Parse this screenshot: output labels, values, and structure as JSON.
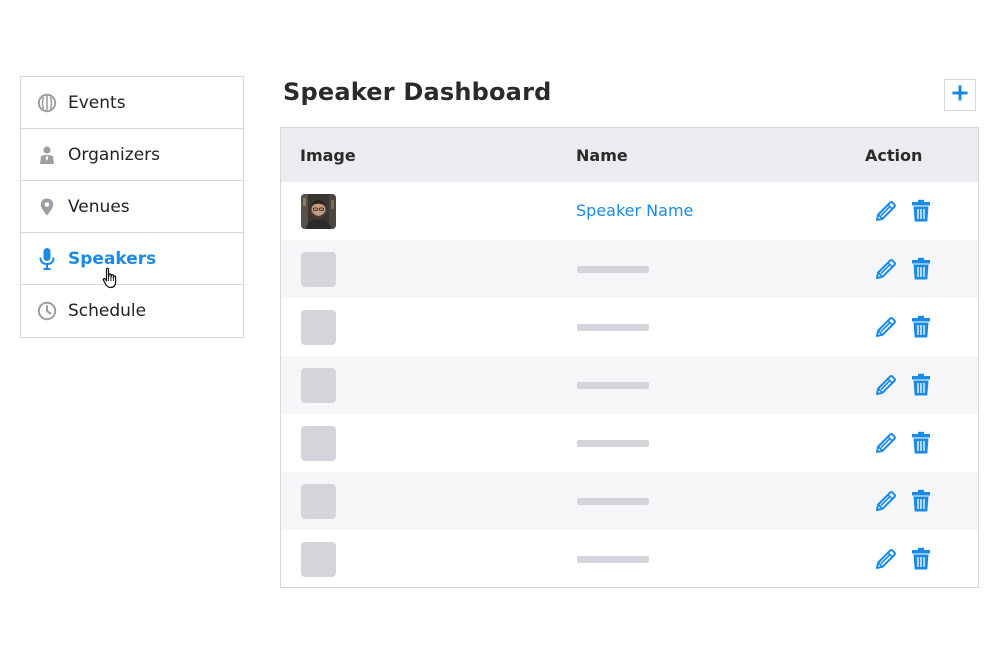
{
  "sidebar": {
    "items": [
      {
        "label": "Events",
        "icon": "globe-icon",
        "active": false
      },
      {
        "label": "Organizers",
        "icon": "person-icon",
        "active": false
      },
      {
        "label": "Venues",
        "icon": "map-pin-icon",
        "active": false
      },
      {
        "label": "Speakers",
        "icon": "microphone-icon",
        "active": true
      },
      {
        "label": "Schedule",
        "icon": "clock-icon",
        "active": false
      }
    ]
  },
  "header": {
    "title": "Speaker Dashboard",
    "add_icon": "plus-icon"
  },
  "table": {
    "columns": [
      "Image",
      "Name",
      "Action"
    ],
    "rows": [
      {
        "name": "Speaker Name",
        "has_photo": true
      },
      {
        "name": "",
        "has_photo": false
      },
      {
        "name": "",
        "has_photo": false
      },
      {
        "name": "",
        "has_photo": false
      },
      {
        "name": "",
        "has_photo": false
      },
      {
        "name": "",
        "has_photo": false
      },
      {
        "name": "",
        "has_photo": false
      }
    ],
    "actions": [
      "pencil-icon",
      "trash-icon"
    ]
  },
  "colors": {
    "accent": "#1a8ae6",
    "icon_gray": "#9aa0a6",
    "header_bg": "#ececf0",
    "placeholder": "#d3d5da"
  }
}
